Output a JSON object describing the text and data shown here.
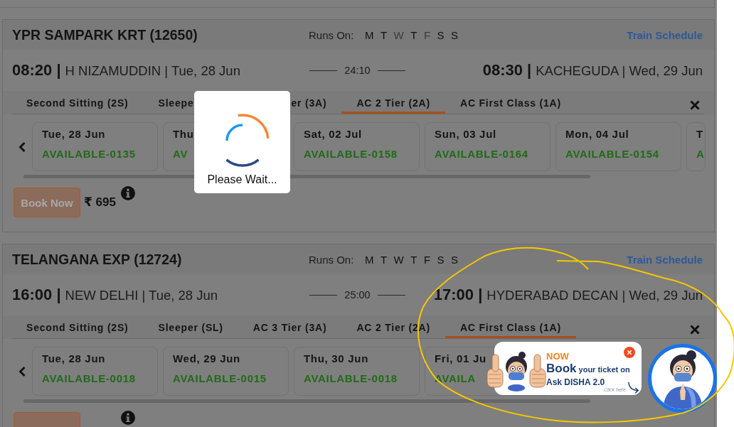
{
  "loading": {
    "message": "Please Wait..."
  },
  "trains": [
    {
      "name": "YPR SAMPARK KRT (12650)",
      "runs_on_label": "Runs On:",
      "days": [
        {
          "letter": "M",
          "runs": true
        },
        {
          "letter": "T",
          "runs": true
        },
        {
          "letter": "W",
          "runs": false
        },
        {
          "letter": "T",
          "runs": true
        },
        {
          "letter": "F",
          "runs": false
        },
        {
          "letter": "S",
          "runs": true
        },
        {
          "letter": "S",
          "runs": true
        }
      ],
      "schedule_link": "Train Schedule",
      "depart": {
        "time": "08:20 |",
        "place": "H NIZAMUDDIN | Tue, 28 Jun"
      },
      "duration": "24:10",
      "arrive": {
        "time": "08:30 |",
        "place": "KACHEGUDA | Wed, 29 Jun"
      },
      "classes": [
        {
          "label": "Second Sitting (2S)",
          "selected": false,
          "cut_end": false,
          "cut_start": false
        },
        {
          "label": "Sleepe",
          "selected": false,
          "cut_end": true,
          "cut_start": false
        },
        {
          "label": "er (3A)",
          "selected": false,
          "cut_end": false,
          "cut_start": true
        },
        {
          "label": "AC 2 Tier (2A)",
          "selected": true,
          "cut_end": false,
          "cut_start": false
        },
        {
          "label": "AC First Class (1A)",
          "selected": false,
          "cut_end": false,
          "cut_start": false
        }
      ],
      "dates": [
        {
          "date": "Tue, 28 Jun",
          "status": "AVAILABLE-0135"
        },
        {
          "date": "Thu",
          "status": "AV"
        },
        {
          "date": "Sat, 02 Jul",
          "status": "AVAILABLE-0158"
        },
        {
          "date": "Sun, 03 Jul",
          "status": "AVAILABLE-0164"
        },
        {
          "date": "Mon, 04 Jul",
          "status": "AVAILABLE-0154"
        },
        {
          "date": "T",
          "status": "A"
        }
      ],
      "book_label": "Book Now",
      "fare": "₹ 695"
    },
    {
      "name": "TELANGANA EXP (12724)",
      "runs_on_label": "Runs On:",
      "days": [
        {
          "letter": "M",
          "runs": true
        },
        {
          "letter": "T",
          "runs": true
        },
        {
          "letter": "W",
          "runs": true
        },
        {
          "letter": "T",
          "runs": true
        },
        {
          "letter": "F",
          "runs": true
        },
        {
          "letter": "S",
          "runs": true
        },
        {
          "letter": "S",
          "runs": true
        }
      ],
      "schedule_link": "Train Schedule",
      "depart": {
        "time": "16:00 |",
        "place": "NEW DELHI | Tue, 28 Jun"
      },
      "duration": "25:00",
      "arrive": {
        "time": "17:00 |",
        "place": "HYDERABAD DECAN | Wed, 29 Jun"
      },
      "classes": [
        {
          "label": "Second Sitting (2S)",
          "selected": false,
          "cut_end": false,
          "cut_start": false
        },
        {
          "label": "Sleeper (SL)",
          "selected": false,
          "cut_end": false,
          "cut_start": false
        },
        {
          "label": "AC 3 Tier (3A)",
          "selected": false,
          "cut_end": false,
          "cut_start": false
        },
        {
          "label": "AC 2 Tier (2A)",
          "selected": false,
          "cut_end": false,
          "cut_start": false
        },
        {
          "label": "AC First Class (1A)",
          "selected": true,
          "cut_end": false,
          "cut_start": false
        }
      ],
      "dates": [
        {
          "date": "Tue, 28 Jun",
          "status": "AVAILABLE-0018"
        },
        {
          "date": "Wed, 29 Jun",
          "status": "AVAILABLE-0015"
        },
        {
          "date": "Thu, 30 Jun",
          "status": "AVAILABLE-0018"
        },
        {
          "date": "Fri, 01 Ju",
          "status": "AVAILA"
        }
      ]
    }
  ],
  "promo": {
    "kicker": "NOW",
    "headline": "**Book** your ticket on",
    "subline": "Ask DISHA 2.0",
    "hint": "Click here"
  }
}
